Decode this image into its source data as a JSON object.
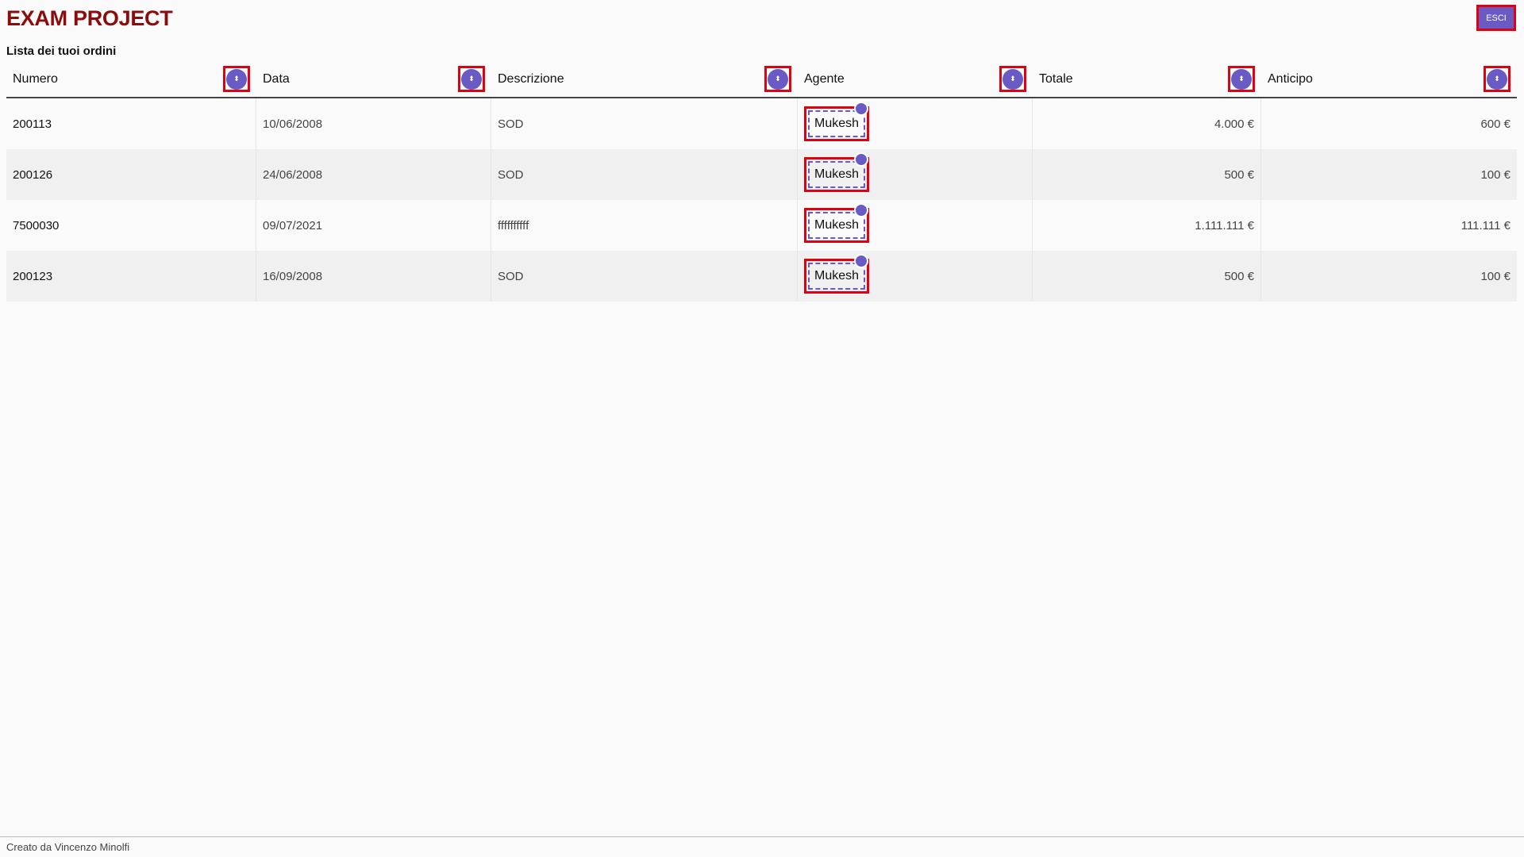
{
  "app": {
    "title": "EXAM PROJECT",
    "logout_label": "ESCI"
  },
  "page": {
    "subtitle": "Lista dei tuoi ordini"
  },
  "table": {
    "headers": [
      "Numero",
      "Data",
      "Descrizione",
      "Agente",
      "Totale",
      "Anticipo"
    ],
    "sort_icon": "sort-updown-icon",
    "rows": [
      [
        "200113",
        "10/06/2008",
        "SOD",
        "Mukesh",
        "4.000 €",
        "600 €"
      ],
      [
        "200126",
        "24/06/2008",
        "SOD",
        "Mukesh",
        "500 €",
        "100 €"
      ],
      [
        "7500030",
        "09/07/2021",
        "ffffffffff",
        "Mukesh",
        "1.111.111 €",
        "111.111 €"
      ],
      [
        "200123",
        "16/09/2008",
        "SOD",
        "Mukesh",
        "500 €",
        "100 €"
      ]
    ]
  },
  "footer": {
    "text": "Creato da Vincenzo Minolfi"
  },
  "colors": {
    "accent": "#6a5bc4",
    "title": "#8b0c0c",
    "highlight": "#e00010"
  }
}
